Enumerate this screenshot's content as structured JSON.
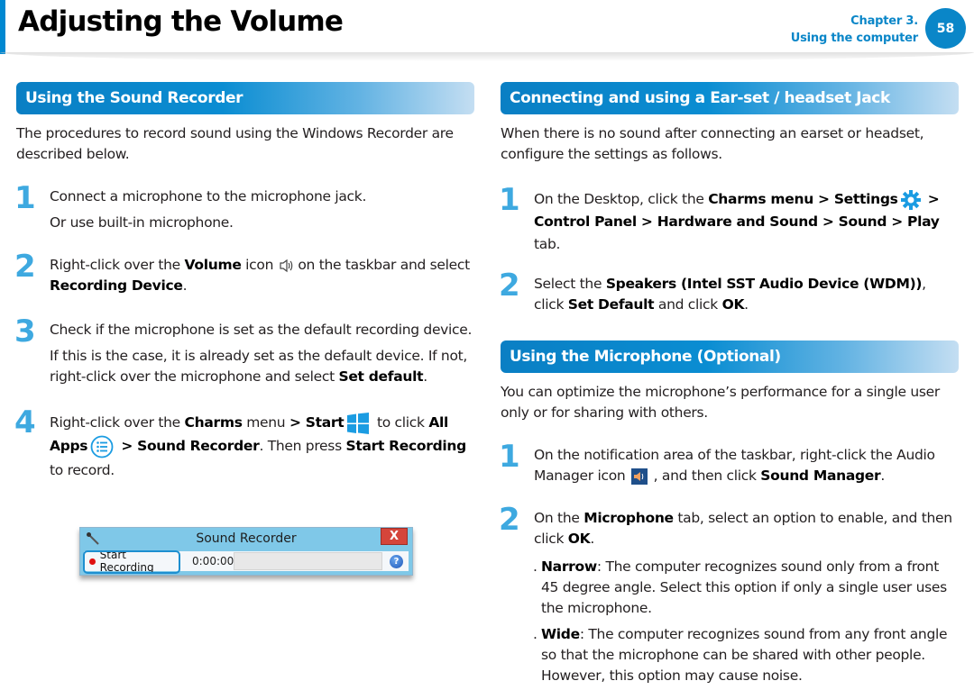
{
  "header": {
    "title": "Adjusting the Volume",
    "chapter": "Chapter 3.",
    "chapter_name": "Using the computer",
    "page_number": "58",
    "accent_color": "#0088d1"
  },
  "left": {
    "section_title": "Using the Sound Recorder",
    "intro": "The procedures to record sound using the Windows Recorder are described below.",
    "steps": [
      {
        "num": "1",
        "line1": "Connect a microphone to the microphone jack.",
        "line2": "Or use built-in microphone."
      },
      {
        "num": "2",
        "pre": "Right-click over the ",
        "b1": "Volume",
        "mid": " icon ",
        "icon": "volume-icon",
        "post": " on the taskbar and select ",
        "b2": "Recording Device",
        "end": "."
      },
      {
        "num": "3",
        "line1": "Check if the microphone is set as the default recording device.",
        "line2_pre": "If this is the case, it is already set as the default device. If not, right-click over the microphone and select ",
        "line2_b": "Set default",
        "line2_end": "."
      },
      {
        "num": "4",
        "pre": "Right-click over the ",
        "b1": "Charms",
        "t1": " menu ",
        "b2": "> Start",
        "icon1": "windows-start-icon",
        "t2": " to click ",
        "b3": "All Apps",
        "icon2": "all-apps-icon",
        "b4": " > Sound Recorder",
        "t3": ". Then press ",
        "b5": "Start Recording",
        "t4": " to record."
      }
    ],
    "recorder": {
      "window_title": "Sound Recorder",
      "start_button": "Start Recording",
      "time": "0:00:00",
      "close_label": "X",
      "help_label": "?"
    }
  },
  "right": {
    "section1": {
      "title": "Connecting and using a Ear-set / headset Jack",
      "intro": "When there is no sound after connecting an earset or headset, configure the settings as follows.",
      "steps": [
        {
          "num": "1",
          "pre": "On the Desktop, click the ",
          "b1": "Charms menu > Settings",
          "icon": "settings-gear-icon",
          "b2": " > Control Panel > Hardware and Sound > Sound > Play",
          "end": " tab."
        },
        {
          "num": "2",
          "pre": "Select the ",
          "b1": "Speakers (Intel SST Audio Device (WDM))",
          "t1": ", click ",
          "b2": "Set Default",
          "t2": " and click ",
          "b3": "OK",
          "end": "."
        }
      ]
    },
    "section2": {
      "title": "Using the Microphone (Optional)",
      "intro": "You can optimize the microphone’s performance for a single user only or for sharing with others.",
      "steps": [
        {
          "num": "1",
          "pre": "On the notification area of the taskbar, right-click the Audio Manager icon ",
          "icon": "audio-manager-icon",
          "t1": " , and then click ",
          "b1": "Sound Manager",
          "end": "."
        },
        {
          "num": "2",
          "pre": "On the ",
          "b1": "Microphone",
          "t1": " tab, select an option to enable, and then click ",
          "b2": "OK",
          "end": "."
        }
      ],
      "options": [
        {
          "marker": ".",
          "label": "Narrow",
          "text": ": The computer recognizes sound only from a front 45 degree angle. Select this option if only a single user uses the microphone."
        },
        {
          "marker": ".",
          "label": "Wide",
          "text": ": The computer recognizes sound from any front angle so that the microphone can be shared with other people. However, this option may cause noise."
        }
      ]
    }
  }
}
